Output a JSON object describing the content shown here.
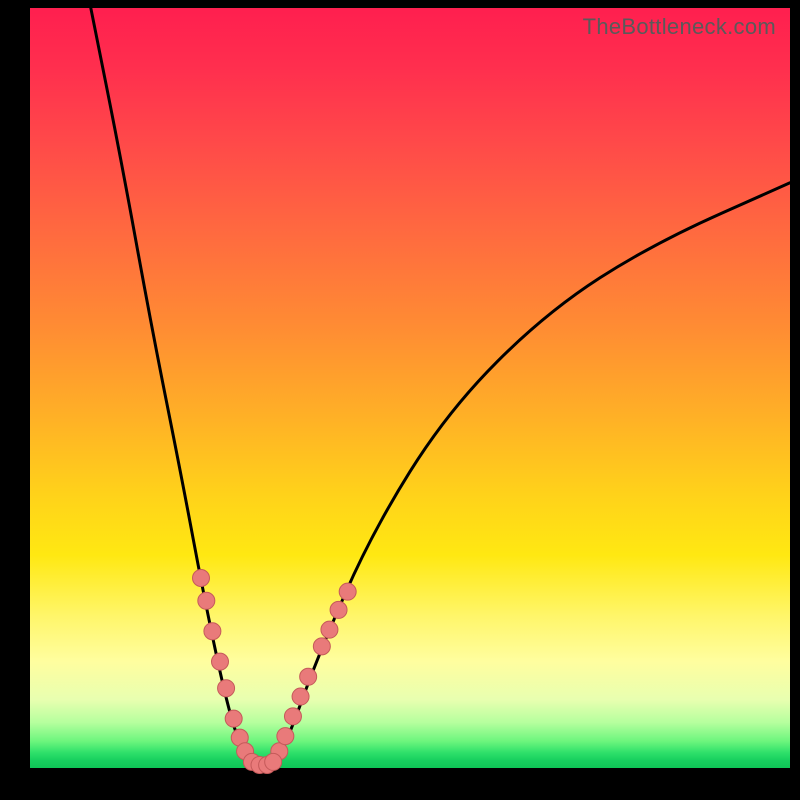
{
  "watermark": "TheBottleneck.com",
  "chart_data": {
    "type": "line",
    "title": "",
    "xlabel": "",
    "ylabel": "",
    "xlim": [
      0,
      100
    ],
    "ylim": [
      0,
      100
    ],
    "curve": {
      "left": [
        {
          "x": 8,
          "y": 100
        },
        {
          "x": 12,
          "y": 80
        },
        {
          "x": 16,
          "y": 58
        },
        {
          "x": 20,
          "y": 38
        },
        {
          "x": 23,
          "y": 22
        },
        {
          "x": 26,
          "y": 8
        },
        {
          "x": 28,
          "y": 2
        },
        {
          "x": 29.5,
          "y": 0
        }
      ],
      "right": [
        {
          "x": 32,
          "y": 0
        },
        {
          "x": 34,
          "y": 4
        },
        {
          "x": 38,
          "y": 15
        },
        {
          "x": 45,
          "y": 31
        },
        {
          "x": 55,
          "y": 47
        },
        {
          "x": 68,
          "y": 60
        },
        {
          "x": 82,
          "y": 69
        },
        {
          "x": 100,
          "y": 77
        }
      ],
      "min": {
        "x": 30.5,
        "y": 0
      }
    },
    "dots_left": [
      {
        "x": 22.5,
        "y": 25
      },
      {
        "x": 23.2,
        "y": 22
      },
      {
        "x": 24.0,
        "y": 18
      },
      {
        "x": 25.0,
        "y": 14
      },
      {
        "x": 25.8,
        "y": 10.5
      },
      {
        "x": 26.8,
        "y": 6.5
      },
      {
        "x": 27.6,
        "y": 4.0
      },
      {
        "x": 28.3,
        "y": 2.2
      }
    ],
    "dots_right": [
      {
        "x": 32.8,
        "y": 2.2
      },
      {
        "x": 33.6,
        "y": 4.2
      },
      {
        "x": 34.6,
        "y": 6.8
      },
      {
        "x": 35.6,
        "y": 9.4
      },
      {
        "x": 36.6,
        "y": 12.0
      },
      {
        "x": 38.4,
        "y": 16.0
      },
      {
        "x": 39.4,
        "y": 18.2
      },
      {
        "x": 40.6,
        "y": 20.8
      },
      {
        "x": 41.8,
        "y": 23.2
      }
    ],
    "dots_bottom": [
      {
        "x": 29.2,
        "y": 0.8
      },
      {
        "x": 30.2,
        "y": 0.4
      },
      {
        "x": 31.2,
        "y": 0.4
      },
      {
        "x": 32.0,
        "y": 0.8
      }
    ],
    "colors": {
      "curve_stroke": "#000000",
      "dot_fill": "#e97a7a",
      "dot_stroke": "#c55a5a"
    }
  }
}
